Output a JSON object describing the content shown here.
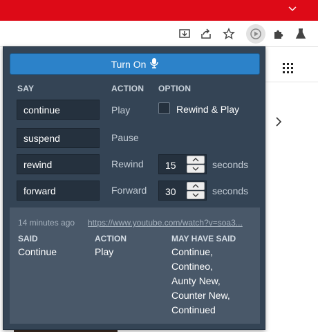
{
  "popup": {
    "turn_on_label": "Turn On",
    "headers": {
      "say": "SAY",
      "action": "ACTION",
      "option": "OPTION"
    },
    "rows": [
      {
        "say": "continue",
        "action": "Play"
      },
      {
        "say": "suspend",
        "action": "Pause"
      },
      {
        "say": "rewind",
        "action": "Rewind",
        "value": "15",
        "unit": "seconds"
      },
      {
        "say": "forward",
        "action": "Forward",
        "value": "30",
        "unit": "seconds"
      }
    ],
    "option_checkbox_label": "Rewind & Play",
    "option_checkbox_checked": false
  },
  "history": {
    "time": "14 minutes ago",
    "url": "https://www.youtube.com/watch?v=soa3...",
    "headers": {
      "said": "SAID",
      "action": "ACTION",
      "may_have_said": "MAY HAVE SAID"
    },
    "said": "Continue",
    "action": "Play",
    "may_have_said": [
      "Continue,",
      "Contineo,",
      "Aunty New,",
      "Counter New,",
      "Continued"
    ]
  },
  "colors": {
    "brand_red": "#dd0a17",
    "popup_bg": "#344455",
    "button_blue": "#2c82c9",
    "history_bg": "#495869"
  },
  "icons": [
    "chevron-down-icon",
    "install-icon",
    "share-icon",
    "star-icon",
    "extension-play-icon",
    "puzzle-icon",
    "lab-flask-icon",
    "apps-grid-icon",
    "chevron-right-icon",
    "microphone-icon",
    "spin-up-icon",
    "spin-down-icon"
  ]
}
